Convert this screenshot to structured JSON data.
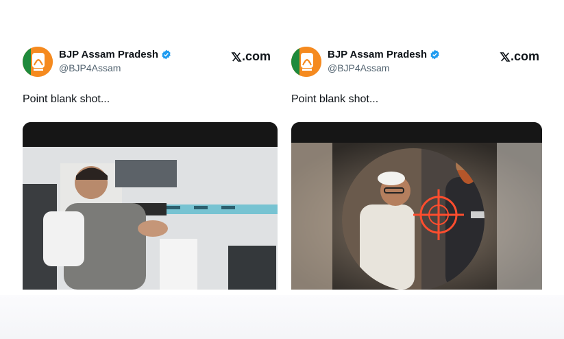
{
  "posts": [
    {
      "account_name": "BJP Assam Pradesh",
      "handle": "@BJP4Assam",
      "site_label": "com",
      "text": "Point blank shot...",
      "verified_icon": "verified-badge-icon",
      "media_description_icon": "video-thumbnail"
    },
    {
      "account_name": "BJP Assam Pradesh",
      "handle": "@BJP4Assam",
      "site_label": "com",
      "text": "Point blank shot...",
      "verified_icon": "verified-badge-icon",
      "media_description_icon": "video-thumbnail"
    }
  ],
  "colors": {
    "verified": "#1d9bf0",
    "text": "#0f1419",
    "secondary": "#536471",
    "logo_orange": "#f58a1f",
    "logo_green": "#1e8a3c"
  }
}
